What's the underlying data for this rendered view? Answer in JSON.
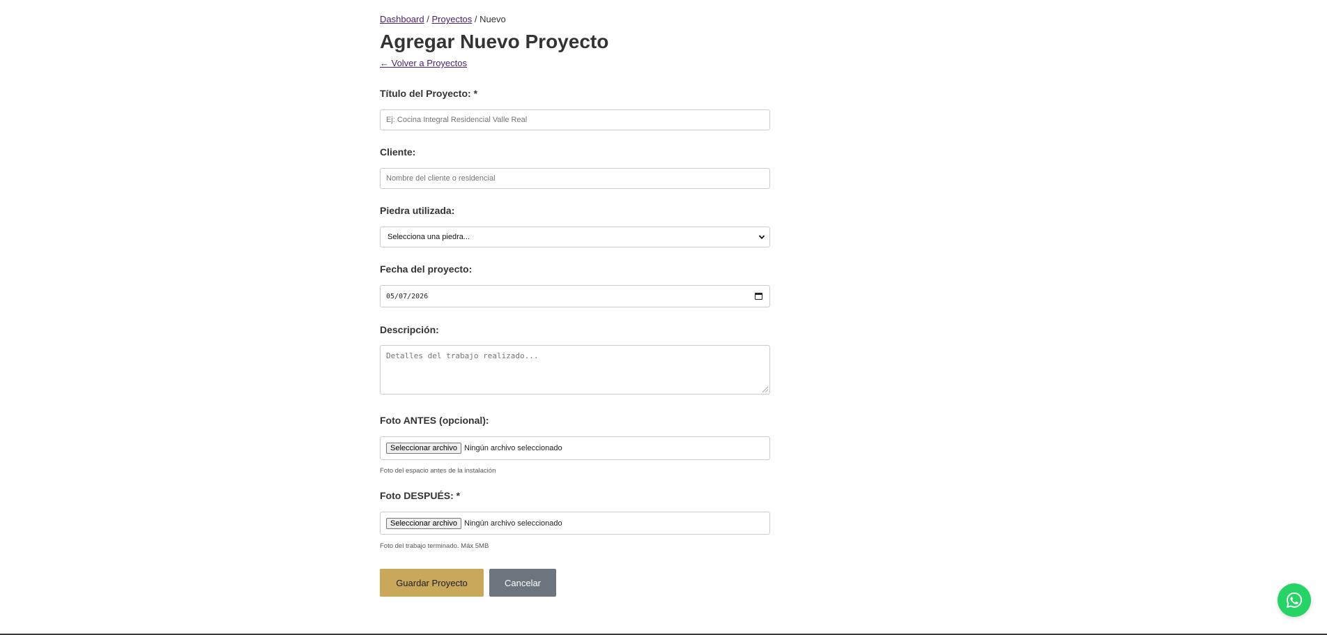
{
  "breadcrumb": {
    "items": [
      "Dashboard",
      "Proyectos"
    ],
    "separator": "/",
    "current": "Nuevo"
  },
  "page": {
    "title": "Agregar Nuevo Proyecto",
    "back_link": "← Volver a Proyectos"
  },
  "form": {
    "title": {
      "label": "Título del Proyecto: *",
      "placeholder": "Ej: Cocina Integral Residencial Valle Real"
    },
    "client": {
      "label": "Cliente:",
      "placeholder": "Nombre del cliente o residencial"
    },
    "stone": {
      "label": "Piedra utilizada:",
      "selected": "Selecciona una piedra..."
    },
    "date": {
      "label": "Fecha del proyecto:",
      "value": "05/07/2026"
    },
    "description": {
      "label": "Descripción:",
      "placeholder": "Detalles del trabajo realizado..."
    },
    "photo_before": {
      "label": "Foto ANTES (opcional):",
      "button": "Seleccionar archivo",
      "status": "Ningún archivo seleccionado",
      "help": "Foto del espacio antes de la instalación"
    },
    "photo_after": {
      "label": "Foto DESPUÉS: *",
      "button": "Seleccionar archivo",
      "status": "Ningún archivo seleccionado",
      "help": "Foto del trabajo terminado. Máx 5MB"
    },
    "actions": {
      "save": "Guardar Proyecto",
      "cancel": "Cancelar"
    }
  },
  "icons": {
    "whatsapp": "whatsapp-icon",
    "select": "chevron-down-icon",
    "date": "calendar-icon"
  },
  "colors": {
    "link": "#4b1f6f",
    "primary_button": "#c9a85c",
    "secondary_button": "#6c757d",
    "whatsapp": "#25d366"
  }
}
